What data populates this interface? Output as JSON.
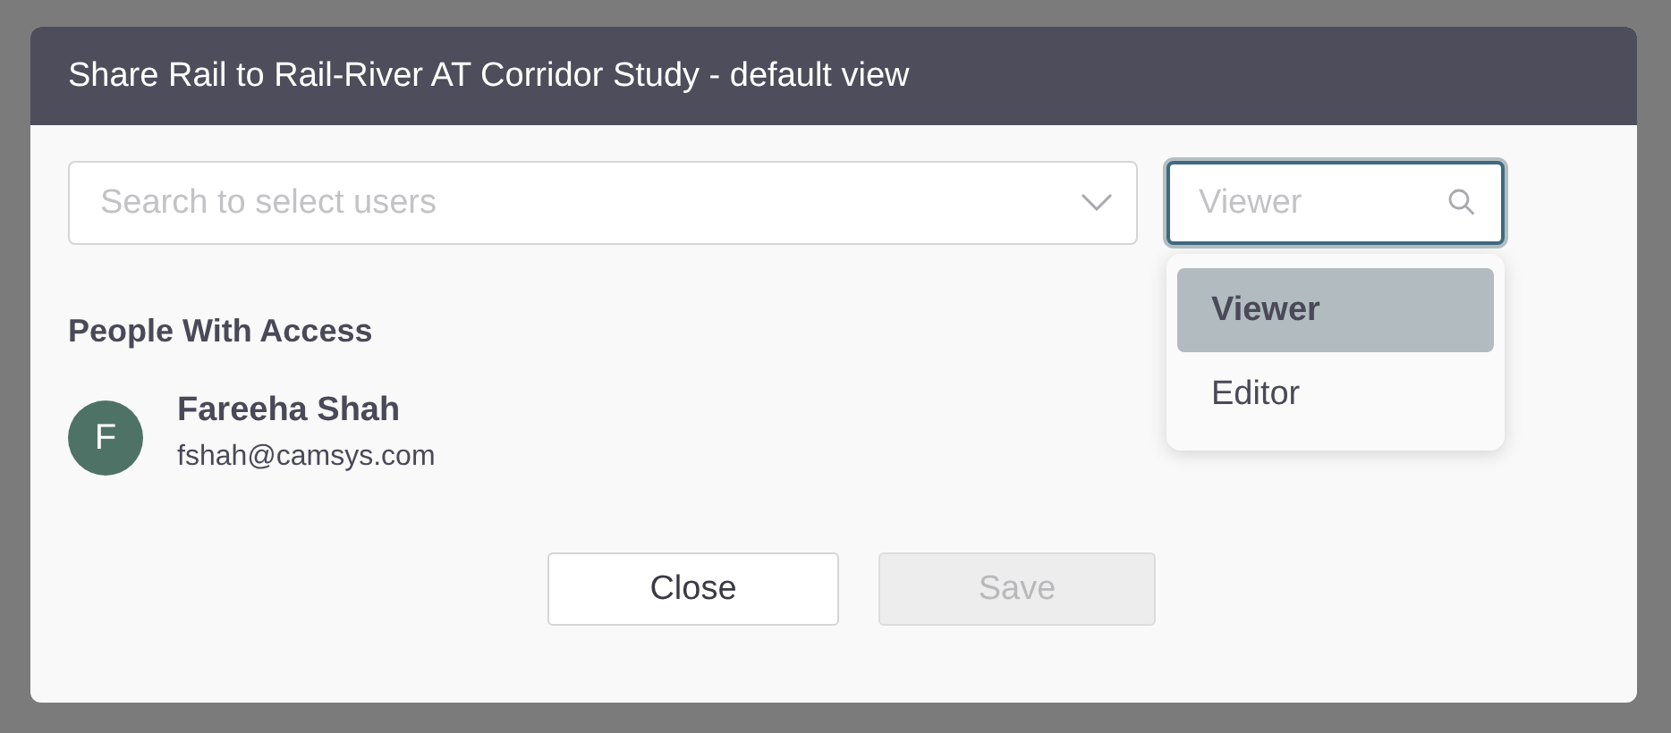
{
  "dialog": {
    "title": "Share Rail to Rail-River AT Corridor Study - default view"
  },
  "user_search": {
    "placeholder": "Search to select users"
  },
  "role_select": {
    "placeholder": "Viewer",
    "expanded": true,
    "options": [
      {
        "label": "Viewer",
        "selected": true
      },
      {
        "label": "Editor",
        "selected": false
      }
    ]
  },
  "access": {
    "heading": "People With Access",
    "people": [
      {
        "initial": "F",
        "name": "Fareeha Shah",
        "email": "fshah@camsys.com"
      }
    ]
  },
  "buttons": [
    {
      "label": "Close",
      "disabled": false
    },
    {
      "label": "Save",
      "disabled": true
    }
  ]
}
